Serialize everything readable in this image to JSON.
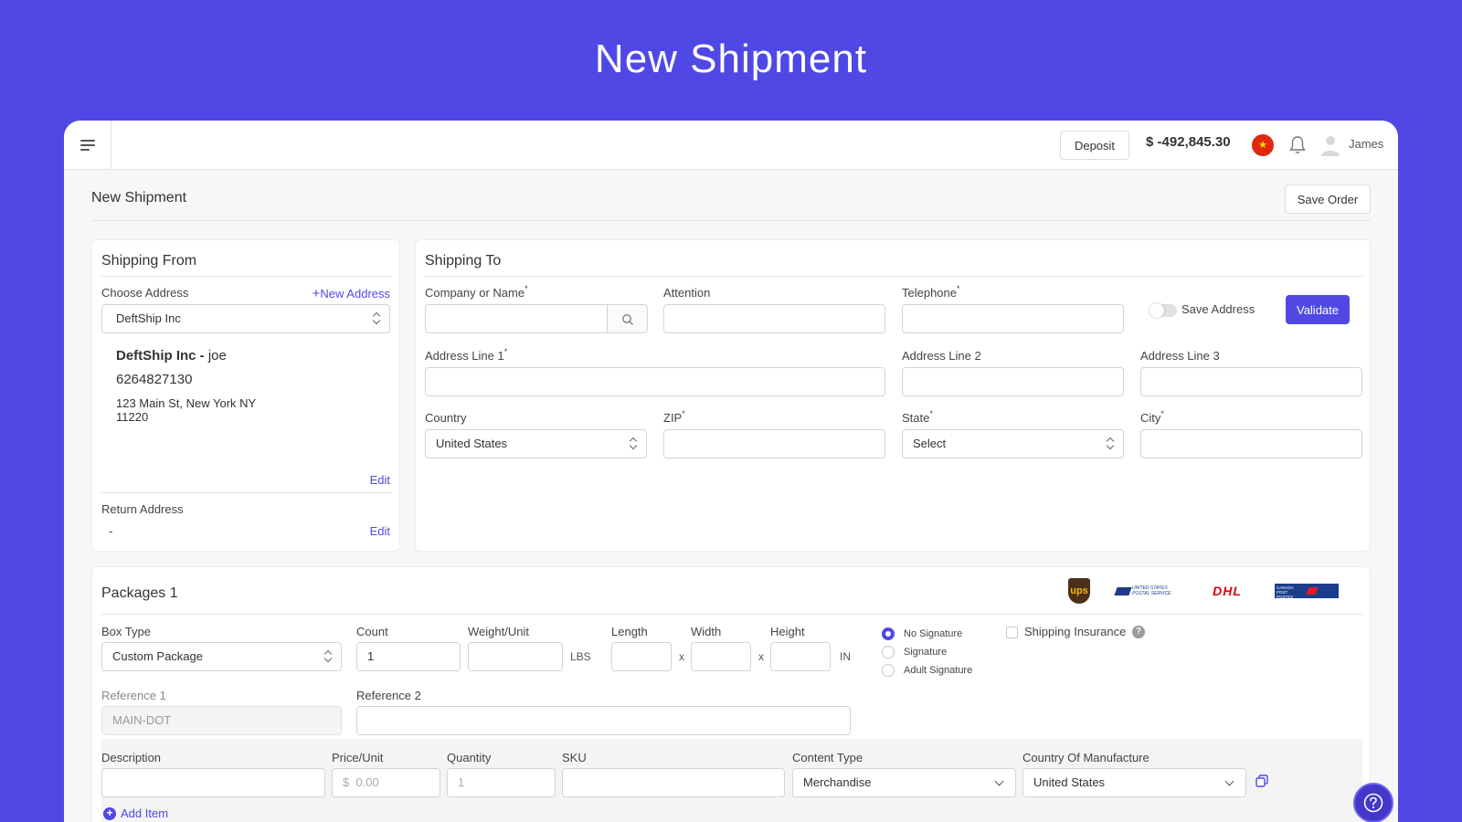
{
  "hero": {
    "title": "New Shipment"
  },
  "topbar": {
    "deposit_label": "Deposit",
    "balance": "$ -492,845.30",
    "flag_glyph": "★",
    "username": "James"
  },
  "page": {
    "title": "New Shipment",
    "save_order_label": "Save Order"
  },
  "shipping_from": {
    "title": "Shipping From",
    "choose_address_label": "Choose Address",
    "new_address_label": "New Address",
    "selected_address": "DeftShip Inc",
    "name_bold": "DeftShip Inc -",
    "contact": "joe",
    "phone": "6264827130",
    "street": "123 Main St, New York NY",
    "zip": "11220",
    "edit_label": "Edit",
    "return_address_label": "Return Address",
    "return_address_value": "-",
    "return_edit_label": "Edit"
  },
  "shipping_to": {
    "title": "Shipping To",
    "company_label": "Company or Name",
    "attention_label": "Attention",
    "telephone_label": "Telephone",
    "save_address_label": "Save Address",
    "validate_label": "Validate",
    "address1_label": "Address Line 1",
    "address2_label": "Address Line 2",
    "address3_label": "Address Line 3",
    "country_label": "Country",
    "country_value": "United States",
    "zip_label": "ZIP",
    "state_label": "State",
    "state_value": "Select",
    "city_label": "City",
    "required_mark": "*"
  },
  "packages": {
    "title": "Packages 1",
    "carriers": [
      "ups",
      "UNITED STATES POSTAL SERVICE",
      "DHL",
      "CANADA POST POSTES CANADA"
    ],
    "box_type_label": "Box Type",
    "box_type_value": "Custom Package",
    "count_label": "Count",
    "count_value": "1",
    "weight_label": "Weight/Unit",
    "weight_unit": "LBS",
    "length_label": "Length",
    "width_label": "Width",
    "height_label": "Height",
    "times": "x",
    "dim_unit": "IN",
    "signature_options": [
      "No Signature",
      "Signature",
      "Adult Signature"
    ],
    "insurance_label": "Shipping Insurance",
    "help_glyph": "?",
    "reference1_label": "Reference 1",
    "reference1_value": "MAIN-DOT",
    "reference2_label": "Reference 2"
  },
  "items": {
    "description_label": "Description",
    "price_label": "Price/Unit",
    "price_currency": "$",
    "price_placeholder": "0.00",
    "quantity_label": "Quantity",
    "quantity_placeholder": "1",
    "sku_label": "SKU",
    "content_type_label": "Content Type",
    "content_type_value": "Merchandise",
    "country_manufacture_label": "Country Of Manufacture",
    "country_manufacture_value": "United States",
    "add_item_label": "Add Item",
    "add_glyph": "+"
  },
  "colors": {
    "accent": "#5048e5",
    "background": "#5048e5"
  }
}
